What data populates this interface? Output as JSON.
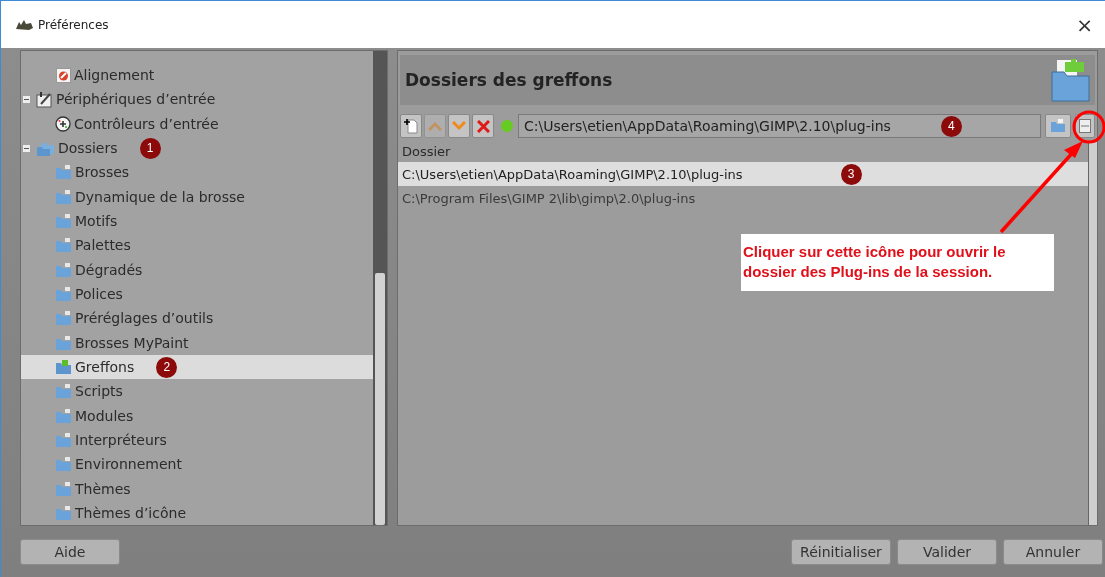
{
  "window": {
    "title": "Préférences",
    "close": "×"
  },
  "tree": [
    {
      "label": "Alignement",
      "kind": "alignment",
      "selected": false
    },
    {
      "label": "Périphériques d’entrée",
      "kind": "input-device",
      "expanded": true,
      "selected": false,
      "children": [
        {
          "label": "Contrôleurs d’entrée",
          "kind": "controller",
          "selected": false
        }
      ]
    },
    {
      "label": "Dossiers",
      "kind": "folders",
      "expanded": true,
      "selected": false,
      "badge": "1",
      "children": [
        {
          "label": "Brosses",
          "kind": "folder",
          "selected": false
        },
        {
          "label": "Dynamique de la brosse",
          "kind": "folder",
          "selected": false
        },
        {
          "label": "Motifs",
          "kind": "folder",
          "selected": false
        },
        {
          "label": "Palettes",
          "kind": "folder",
          "selected": false
        },
        {
          "label": "Dégradés",
          "kind": "folder",
          "selected": false
        },
        {
          "label": "Polices",
          "kind": "folder",
          "selected": false
        },
        {
          "label": "Préréglages d’outils",
          "kind": "folder",
          "selected": false
        },
        {
          "label": "Brosses MyPaint",
          "kind": "folder",
          "selected": false
        },
        {
          "label": "Greffons",
          "kind": "plugin-folder",
          "selected": true,
          "badge": "2"
        },
        {
          "label": "Scripts",
          "kind": "folder",
          "selected": false
        },
        {
          "label": "Modules",
          "kind": "folder",
          "selected": false
        },
        {
          "label": "Interpréteurs",
          "kind": "folder",
          "selected": false
        },
        {
          "label": "Environnement",
          "kind": "folder",
          "selected": false
        },
        {
          "label": "Thèmes",
          "kind": "folder",
          "selected": false
        },
        {
          "label": "Thèmes d’icône",
          "kind": "folder",
          "selected": false
        }
      ]
    }
  ],
  "section": {
    "title": "Dossiers des greffons"
  },
  "toolbar": [
    {
      "kind": "new",
      "disabled": false
    },
    {
      "kind": "up",
      "disabled": true
    },
    {
      "kind": "down",
      "disabled": false
    },
    {
      "kind": "delete",
      "disabled": false
    }
  ],
  "path_field": {
    "valid": true,
    "value": "C:\\Users\\etien\\AppData\\Roaming\\GIMP\\2.10\\plug-ins",
    "badge": "4"
  },
  "folder_list": {
    "column": "Dossier",
    "rows": [
      {
        "path": "C:\\Users\\etien\\AppData\\Roaming\\GIMP\\2.10\\plug-ins",
        "selected": true,
        "badge": "3"
      },
      {
        "path": "C:\\Program Files\\GIMP 2\\lib\\gimp\\2.0\\plug-ins",
        "selected": false
      }
    ]
  },
  "callout": {
    "text": "Cliquer sur cette icône pour ouvrir le dossier des Plug-ins de la session."
  },
  "buttons": {
    "help": "Aide",
    "actions": [
      "Réinitialiser",
      "Valider",
      "Annuler"
    ]
  }
}
